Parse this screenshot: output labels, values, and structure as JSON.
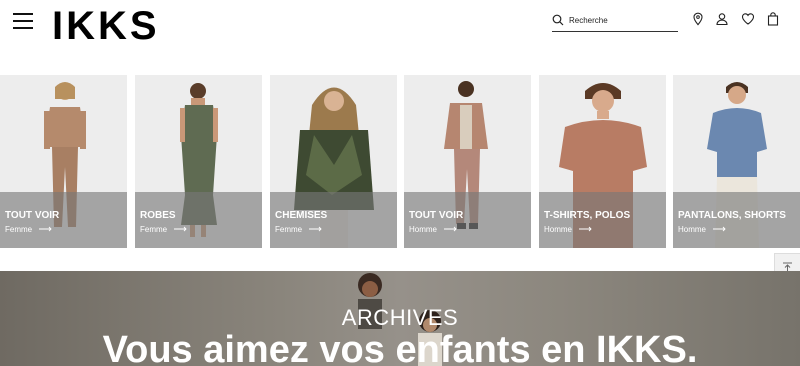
{
  "header": {
    "logo": "IKKS",
    "search": {
      "placeholder": "Recherche"
    },
    "icons": [
      "menu-icon",
      "search-icon",
      "store-locator-icon",
      "account-icon",
      "wishlist-icon",
      "bag-icon"
    ]
  },
  "categories": [
    {
      "label": "TOUT VOIR",
      "sub": "Femme"
    },
    {
      "label": "ROBES",
      "sub": "Femme"
    },
    {
      "label": "CHEMISES",
      "sub": "Femme"
    },
    {
      "label": "TOUT VOIR",
      "sub": "Homme"
    },
    {
      "label": "T-SHIRTS, POLOS",
      "sub": "Homme"
    },
    {
      "label": "PANTALONS, SHORTS",
      "sub": "Homme"
    }
  ],
  "hero": {
    "eyebrow": "ARCHIVES",
    "headline": "Vous aimez vos enfants en IKKS."
  },
  "colors": {
    "text": "#111111",
    "overlay": "#787878",
    "tile_bg": "#ededed"
  }
}
